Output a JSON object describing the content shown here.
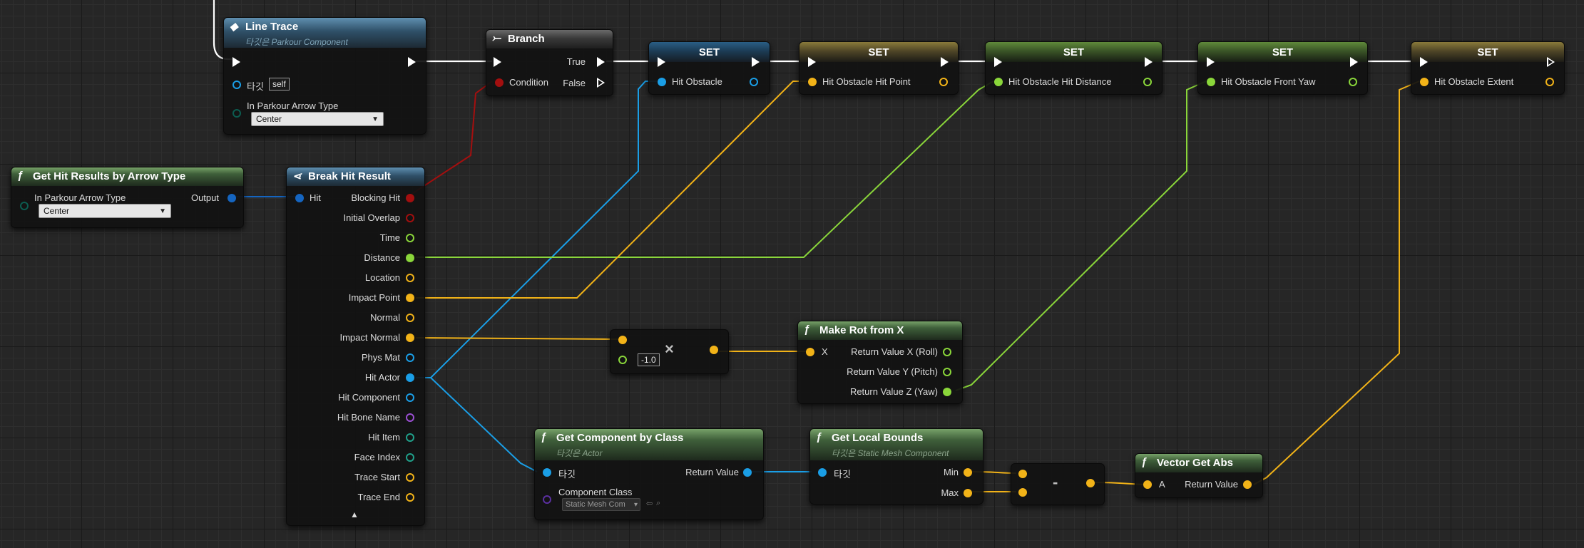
{
  "colors": {
    "exec": "#ffffff",
    "object": "#1a9ee6",
    "vector": "#f2b318",
    "float": "#8ad63a",
    "bool": "#a30f0f",
    "struct_blue": "#1565c0",
    "rotator": "#8ad63a",
    "purple": "#9b4fd3",
    "teal": "#20a08a"
  },
  "line_trace": {
    "title": "Line Trace",
    "subtitle": "타깃은 Parkour Component",
    "target_label": "타깃",
    "target_value": "self",
    "arrow_type_label": "In Parkour Arrow Type",
    "arrow_type_value": "Center"
  },
  "get_hit_results": {
    "title": "Get Hit Results by Arrow Type",
    "arrow_type_label": "In Parkour Arrow Type",
    "arrow_type_value": "Center",
    "output_label": "Output"
  },
  "branch": {
    "title": "Branch",
    "true_label": "True",
    "false_label": "False",
    "condition_label": "Condition"
  },
  "break_hit": {
    "title": "Break Hit Result",
    "input_label": "Hit",
    "outputs": [
      "Blocking Hit",
      "Initial Overlap",
      "Time",
      "Distance",
      "Location",
      "Impact Point",
      "Normal",
      "Impact Normal",
      "Phys Mat",
      "Hit Actor",
      "Hit Component",
      "Hit Bone Name",
      "Hit Item",
      "Face Index",
      "Trace Start",
      "Trace End"
    ]
  },
  "sets": [
    {
      "title": "SET",
      "var": "Hit Obstacle"
    },
    {
      "title": "SET",
      "var": "Hit Obstacle Hit Point"
    },
    {
      "title": "SET",
      "var": "Hit Obstacle Hit Distance"
    },
    {
      "title": "SET",
      "var": "Hit Obstacle Front Yaw"
    },
    {
      "title": "SET",
      "var": "Hit Obstacle Extent"
    }
  ],
  "multiply": {
    "value": "-1.0",
    "symbol": "×"
  },
  "make_rot": {
    "title": "Make Rot from X",
    "input_label": "X",
    "out_x": "Return Value X (Roll)",
    "out_y": "Return Value Y (Pitch)",
    "out_z": "Return Value Z (Yaw)"
  },
  "get_component": {
    "title": "Get Component by Class",
    "subtitle": "타깃은 Actor",
    "target_label": "타깃",
    "return_label": "Return Value",
    "class_label": "Component Class",
    "class_value": "Static Mesh Com"
  },
  "get_local_bounds": {
    "title": "Get Local Bounds",
    "subtitle": "타깃은 Static Mesh Component",
    "target_label": "타깃",
    "min_label": "Min",
    "max_label": "Max"
  },
  "subtract": {
    "symbol": "-"
  },
  "vector_abs": {
    "title": "Vector Get Abs",
    "input_label": "A",
    "return_label": "Return Value"
  }
}
